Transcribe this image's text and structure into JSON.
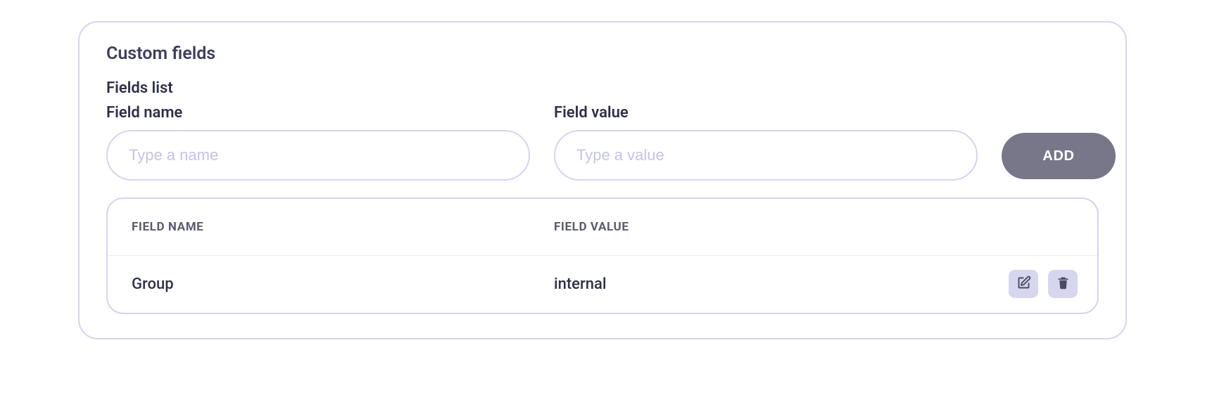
{
  "panel": {
    "title": "Custom fields"
  },
  "fields_list": {
    "title": "Fields list",
    "name_label": "Field name",
    "value_label": "Field value",
    "name_placeholder": "Type a name",
    "value_placeholder": "Type a value",
    "name_value": "",
    "value_value": "",
    "add_label": "ADD"
  },
  "table": {
    "headers": {
      "name": "FIELD NAME",
      "value": "FIELD VALUE"
    },
    "rows": [
      {
        "name": "Group",
        "value": "internal"
      }
    ]
  }
}
